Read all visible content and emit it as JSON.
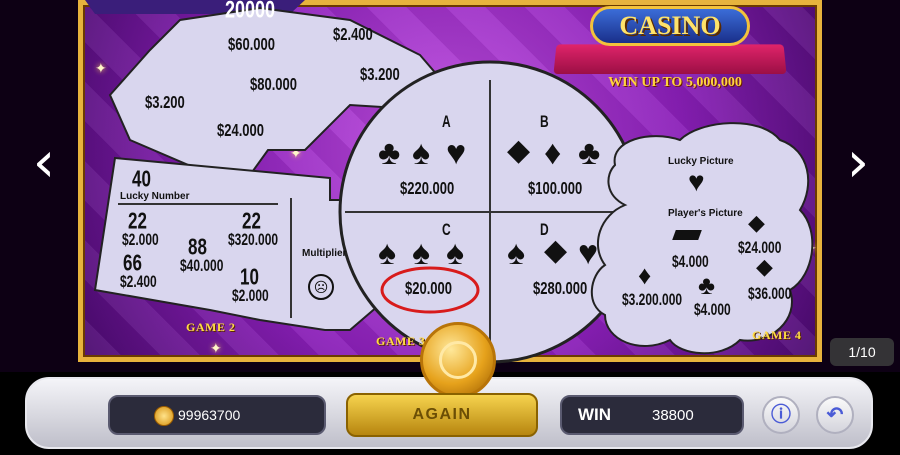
{
  "logo": {
    "title": "CASINO",
    "subtitle": "WIN UP TO 5,000,000"
  },
  "prize_top": "20000",
  "game1": {
    "prizes": [
      "$60.000",
      "$2.400",
      "$80.000",
      "$3.200",
      "$3.200",
      "$24.000"
    ]
  },
  "game2": {
    "lucky_value": "40",
    "lucky_label": "Lucky Number",
    "numbers": [
      {
        "num": "22",
        "prize": "$2.000"
      },
      {
        "num": "22",
        "prize": "$320.000"
      },
      {
        "num": "88",
        "prize": "$40.000"
      },
      {
        "num": "66",
        "prize": "$2.400"
      },
      {
        "num": "10",
        "prize": "$2.000"
      }
    ],
    "multiplier_label": "Multiplier",
    "multiplier_icon": "sad-face-icon",
    "label": "GAME 2"
  },
  "game3": {
    "label": "GAME 3",
    "quadrants": [
      {
        "letter": "A",
        "suits": [
          "club-icon",
          "spade-icon",
          "heart-icon"
        ],
        "prize": "$220.000"
      },
      {
        "letter": "B",
        "suits": [
          "diamond-gem-icon",
          "diamond-icon",
          "club-icon"
        ],
        "prize": "$100.000"
      },
      {
        "letter": "C",
        "suits": [
          "spade-icon",
          "spade-icon",
          "spade-icon"
        ],
        "prize": "$20.000",
        "winner": true
      },
      {
        "letter": "D",
        "suits": [
          "spade-icon",
          "diamond-gem-icon",
          "heart-icon"
        ],
        "prize": "$280.000"
      }
    ]
  },
  "game4": {
    "label": "GAME 4",
    "lucky_picture_label": "Lucky Picture",
    "lucky_picture_icon": "heart-icon",
    "players_picture_label": "Player's Picture",
    "pictures": [
      {
        "icon": "gem-icon",
        "prize": "$24.000"
      },
      {
        "icon": "gold-bars-icon",
        "prize": "$4.000"
      },
      {
        "icon": "gem-icon",
        "prize": "$36.000"
      },
      {
        "icon": "diamond-icon",
        "prize": "$3.200.000"
      },
      {
        "icon": "club-icon",
        "prize": "$4.000"
      }
    ]
  },
  "pager": "1/10",
  "bottom": {
    "balance": "99963700",
    "again_label": "AGAIN",
    "win_label": "WIN",
    "win_value": "38800"
  },
  "colors": {
    "board_frame": "#e7b33d",
    "scratch_area": "#d9d6ee",
    "winner_circle": "#d81b1b",
    "game_label": "#ffdc43"
  }
}
